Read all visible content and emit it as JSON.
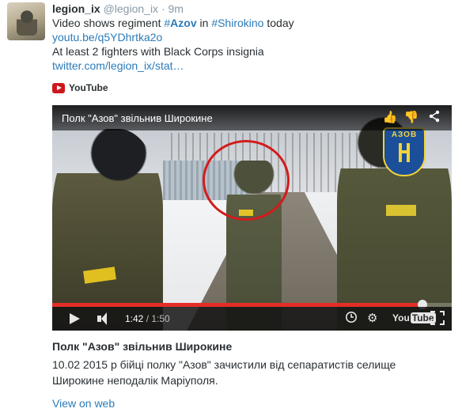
{
  "header": {
    "name": "legion_ix",
    "handle": "@legion_ix",
    "separator": "·",
    "time": "9m"
  },
  "tweet": {
    "line1_pre": "Video shows regiment ",
    "hashtag1_hash": "#",
    "hashtag1_text": "Azov",
    "line1_mid": " in ",
    "hashtag2": "#Shirokino",
    "line1_post": " today",
    "link1": "youtu.be/q5YDhrtka2o",
    "line3": "At least 2 fighters with Black Corps insignia",
    "link2": "twitter.com/legion_ix/stat…"
  },
  "media_source": {
    "label": "YouTube",
    "icon": "youtube-icon",
    "color": "#cc181e"
  },
  "video": {
    "title": "Полк \"Азов\" звільнив Широкине",
    "patch_text": "АЗОВ",
    "current_time": "1:42",
    "separator": " / ",
    "duration": "1:50",
    "progress_fraction": 0.9273,
    "logo_you": "You",
    "logo_tube": "Tube",
    "title_icons": [
      "thumbs-up-icon",
      "thumbs-down-icon",
      "share-icon"
    ],
    "control_icons": [
      "play-icon",
      "volume-icon",
      "watch-later-icon",
      "settings-gear-icon",
      "youtube-logo",
      "fullscreen-icon"
    ],
    "accent": "#e52d27"
  },
  "card": {
    "title": "Полк \"Азов\" звільнив Широкине",
    "desc_line1": "10.02 2015 р бійці полку \"Азов\" зачистили від сепаратистів селище",
    "desc_line2": "Широкине неподалік Маріуполя.",
    "view_on_web": "View on web"
  },
  "colors": {
    "link": "#2b7bb9",
    "text": "#292f33",
    "muted": "#8899a6",
    "highlight_circle": "#d31b1b"
  }
}
